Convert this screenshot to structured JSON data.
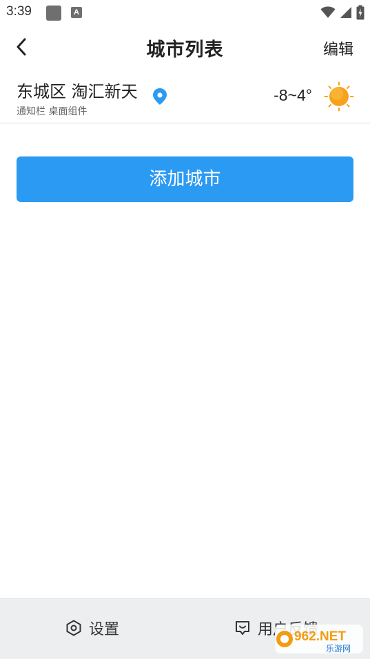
{
  "status_bar": {
    "time": "3:39",
    "notif_badge": "A",
    "icons": [
      "notification-square-icon",
      "notification-a-icon",
      "wifi-icon",
      "cellular-signal-icon",
      "battery-icon"
    ]
  },
  "header": {
    "title": "城市列表",
    "edit_label": "编辑",
    "back_icon": "chevron-left-icon"
  },
  "city_list": [
    {
      "name": "东城区 淘汇新天",
      "subtitle": "通知栏 桌面组件",
      "temperature": "-8~4°",
      "location_icon": "location-pin-icon",
      "weather_icon": "sun-icon"
    }
  ],
  "add_city_label": "添加城市",
  "bottom_bar": {
    "settings_label": "设置",
    "feedback_label": "用户反馈"
  },
  "watermark": {
    "text_main": "962.NET",
    "text_sub": "乐游网"
  },
  "colors": {
    "accent": "#2b9af3",
    "location_pin": "#2b9af3",
    "sun": "#f7a21b",
    "bottom_bar_bg": "#eceeef"
  }
}
